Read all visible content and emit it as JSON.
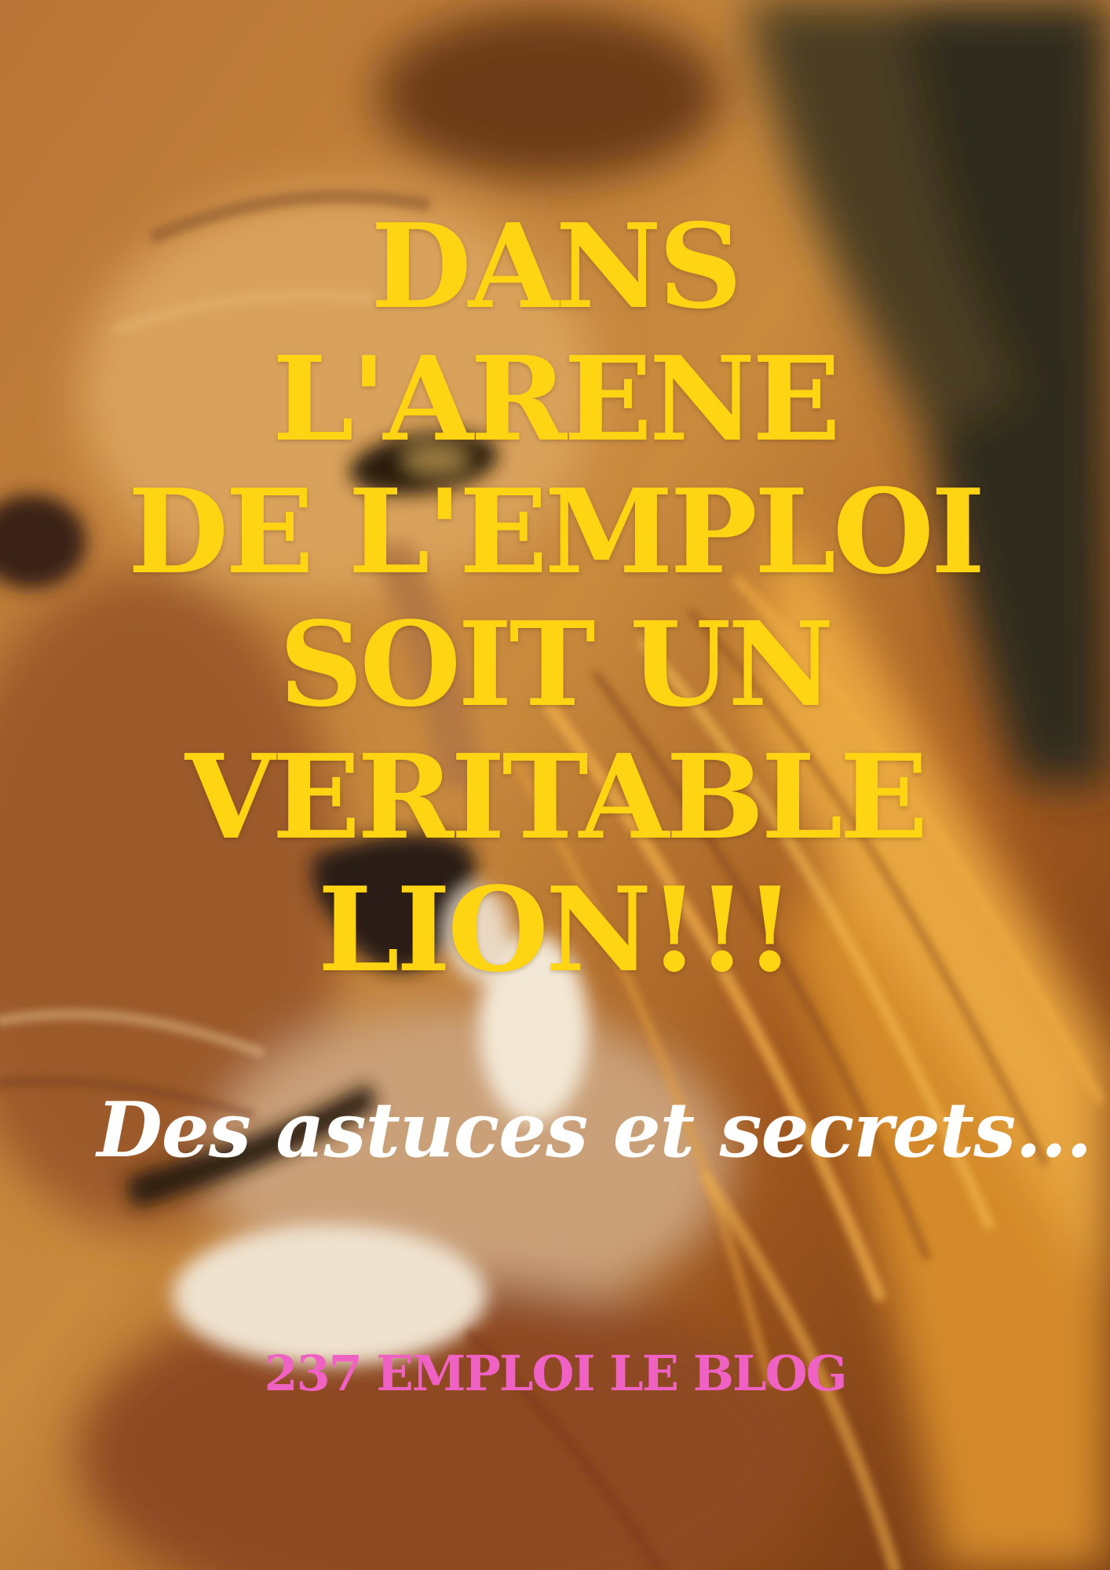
{
  "poster": {
    "title": "DANS\nL'ARENE\nDE L'EMPLOI\nSOIT UN\nVERITABLE\nLION!!!",
    "subtitle": "Des astuces et secrets...",
    "footer": "237 EMPLOI LE BLOG",
    "background_image": "lion-face-closeup",
    "colors": {
      "title": "#ffd413",
      "subtitle": "#ffffff",
      "footer": "#f061c4"
    }
  }
}
